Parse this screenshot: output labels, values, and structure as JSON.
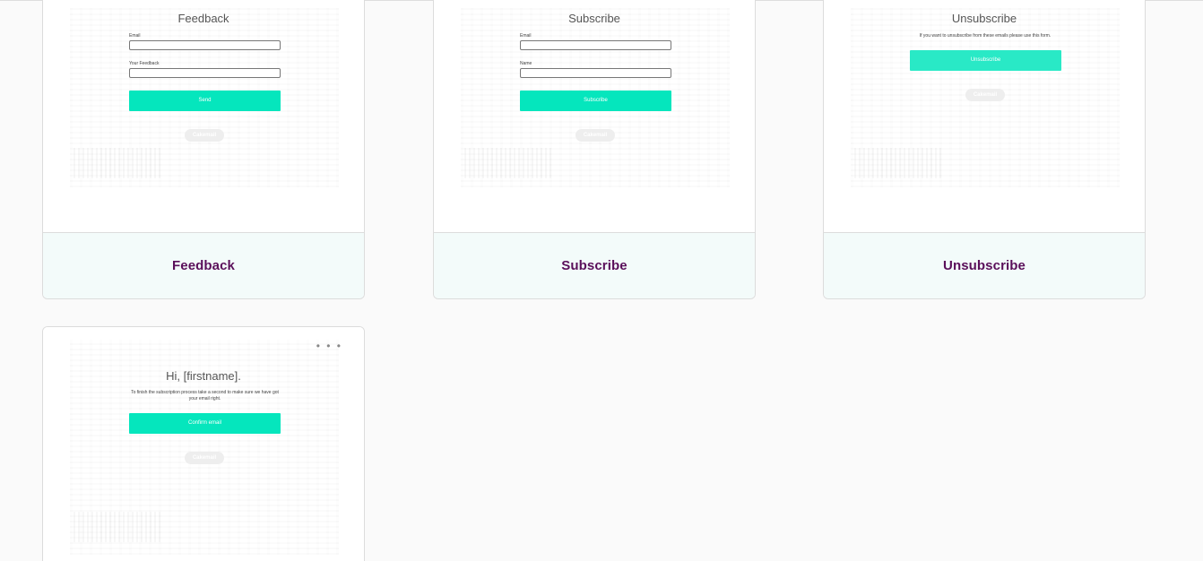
{
  "colors": {
    "accent": "#05e6bd",
    "accent_light": "#29e9c6",
    "title_purple": "#5a0f5a"
  },
  "cards": {
    "feedback": {
      "preview": {
        "title": "Feedback",
        "email_label": "Email",
        "feedback_label": "Your Feedback",
        "button_label": "Send",
        "badge": "Cakemail"
      },
      "footer_title": "Feedback"
    },
    "subscribe": {
      "preview": {
        "title": "Subscribe",
        "email_label": "Email",
        "name_label": "Name",
        "button_label": "Subscribe",
        "badge": "Cakemail"
      },
      "footer_title": "Subscribe"
    },
    "unsubscribe": {
      "preview": {
        "title": "Unsubscribe",
        "note": "If you want to unsubscribe from these emails please use this form.",
        "button_label": "Unsubscribe",
        "badge": "Cakemail"
      },
      "footer_title": "Unsubscribe"
    },
    "confirm": {
      "more_icon": "more-horizontal-icon",
      "more_label": "• • •",
      "preview": {
        "title": "Hi, [firstname].",
        "note": "To finish the subscription process take a second to make sure we have got your email right.",
        "button_label": "Confirm email",
        "badge": "Cakemail"
      }
    }
  }
}
